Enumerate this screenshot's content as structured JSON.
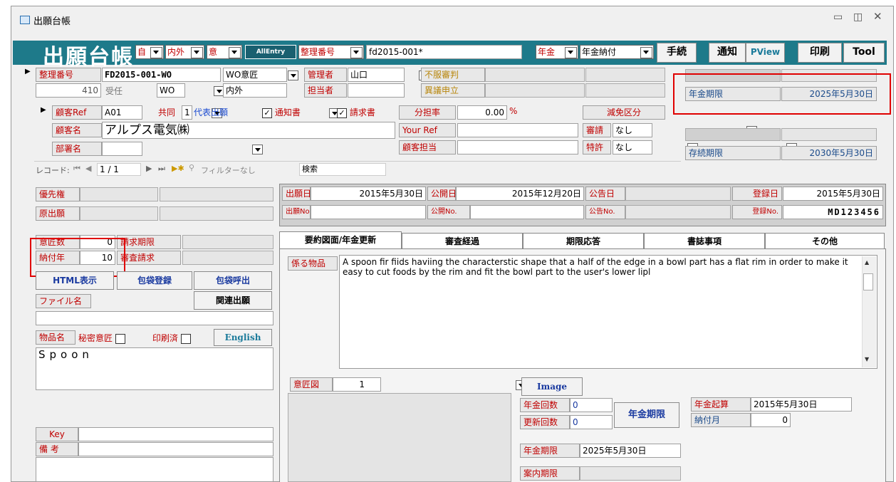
{
  "window": {
    "title": "出願台帳"
  },
  "header": {
    "title": "出願台帳",
    "dd1": "自",
    "dd2": "内外",
    "dd3": "意",
    "allentry": "AllEntry",
    "mgmt_label": "整理番号",
    "mgmt_value": "fd2015-001*",
    "nenkin_dd": "年金",
    "nenkin_nofu_dd": "年金納付",
    "btn_tetsuzuki": "手続",
    "btn_tsuchi": "通知",
    "btn_pview": "PView",
    "btn_print": "印刷",
    "btn_tool": "Tool"
  },
  "form": {
    "seiri_label": "整理番号",
    "seiri_value": "FD2015-001-WO",
    "wo_isho": "WO意匠",
    "kanrisha_label": "管理者",
    "kanrisha_value": "山口",
    "fufuku": "不服審判",
    "id_num": "410",
    "juin": "受任",
    "wo_dd": "WO",
    "naigai": "内外",
    "tantosha_label": "担当者",
    "igi": "異議申立",
    "nenkin_kigen_label": "年金期限",
    "nenkin_kigen_value": "2025年5月30日",
    "kokyaku_ref_label": "顧客Ref",
    "kokyaku_ref_value": "A01",
    "kyodo": "共同",
    "kyodo_num": "1",
    "daihyo": "代表出願",
    "tsuchisho": "通知書",
    "seikyusho": "請求書",
    "buntan_label": "分担率",
    "buntan_value": "0.00",
    "pct": "%",
    "genmen": "減免区分",
    "kokyaku_name_label": "顧客名",
    "kokyaku_name_value": "アルプス電気㈱",
    "your_ref": "Your Ref",
    "shinsei_label": "審請",
    "shinsei_value": "なし",
    "busho_label": "部署名",
    "kokyaku_tanto": "顧客担当",
    "tokkyo_label": "特許",
    "tokkyo_value": "なし",
    "sonzoku_label": "存続期限",
    "sonzoku_value": "2030年5月30日"
  },
  "nav": {
    "record_label": "レコード:",
    "position": "1 / 1",
    "filter": "フィルターなし",
    "search": "検索"
  },
  "left": {
    "yusen": "優先権",
    "genshutsugan": "原出願",
    "ishosu_label": "意匠数",
    "ishosu_value": "0",
    "seikyu_kigen": "請求期限",
    "nofunen_label": "納付年",
    "nofunen_value": "10",
    "shinsa_seikyu": "審査請求",
    "btn_html": "HTML表示",
    "btn_hotai_toroku": "包袋登録",
    "btn_hotai_yobidashi": "包袋呼出",
    "file_label": "ファイル名",
    "btn_kanren": "関連出願",
    "buppin_label": "物品名",
    "himitsu": "秘密意匠",
    "insatsu": "印刷済",
    "btn_english": "English",
    "buppin_value": "Spoon",
    "key_label": "Key",
    "biko_label": "備 考"
  },
  "dates": {
    "shutsugan_label": "出願日",
    "shutsugan_value": "2015年5月30日",
    "kokai_label": "公開日",
    "kokai_value": "2015年12月20日",
    "kokoku_label": "公告日",
    "toroku_label": "登録日",
    "toroku_value": "2015年5月30日",
    "shutsugan_no": "出願No.",
    "kokai_no": "公開No.",
    "kokoku_no": "公告No.",
    "toroku_no_label": "登録No.",
    "toroku_no_value": "MD123456"
  },
  "tabs": [
    "要約図面/年金更新",
    "審査経過",
    "期限応答",
    "書誌事項",
    "その他"
  ],
  "main": {
    "kakaru_label": "係る物品",
    "description": "A spoon fir fiids haviing the characterstic shape that a half of the edge in a bowl part has a flat rim in order to make it easy to cut foods by the rim and fit the bowl part to the user's lower lipl",
    "ishozu_label": "意匠図",
    "ishozu_value": "1",
    "btn_image": "Image",
    "nenkin_kaisu_label": "年金回数",
    "nenkin_kaisu_value": "0",
    "koshin_kaisu_label": "更新回数",
    "koshin_kaisu_value": "0",
    "btn_nenkin_kigen": "年金期限",
    "nenkin_kisan_label": "年金起算",
    "nenkin_kisan_value": "2015年5月30日",
    "nofu_tsuki_label": "納付月",
    "nofu_tsuki_value": "0",
    "nenkin_kigen_label": "年金期限",
    "nenkin_kigen_value": "2025年5月30日",
    "annai_kigen_label": "案内期限"
  }
}
